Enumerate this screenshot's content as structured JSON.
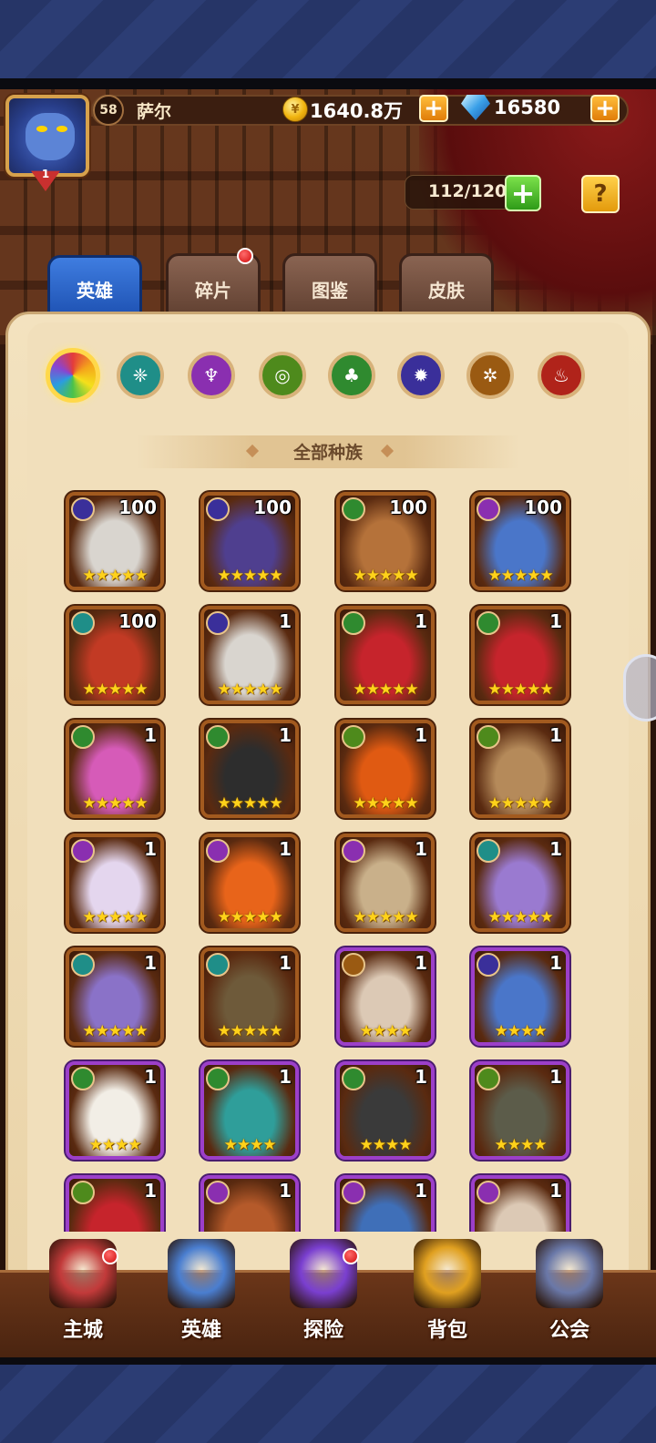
{
  "player": {
    "level": "58",
    "name": "萨尔",
    "vip_level": "1"
  },
  "resources": {
    "gold_icon": "¥",
    "gold": "1640.8万",
    "gems": "16580",
    "stamina": "112/120"
  },
  "buttons": {
    "plus": "+",
    "help": "?"
  },
  "tabs": [
    {
      "label": "英雄",
      "active": true
    },
    {
      "label": "碎片",
      "active": false,
      "notification": true
    },
    {
      "label": "图鉴",
      "active": false
    },
    {
      "label": "皮肤",
      "active": false
    }
  ],
  "race_filters": [
    {
      "name": "all-races",
      "selected": true,
      "color": "rainbow",
      "glyph": ""
    },
    {
      "name": "race-teal",
      "color": "#1f8e88",
      "glyph": "❈"
    },
    {
      "name": "race-purple",
      "color": "#8a2fb0",
      "glyph": "♆"
    },
    {
      "name": "race-green-yellow",
      "color": "#4e8a1c",
      "glyph": "◎"
    },
    {
      "name": "race-forest",
      "color": "#2f8a2f",
      "glyph": "♣"
    },
    {
      "name": "race-indigo",
      "color": "#3a2f9a",
      "glyph": "✹"
    },
    {
      "name": "race-gold",
      "color": "#9a5a12",
      "glyph": "✲"
    },
    {
      "name": "race-red",
      "color": "#b0231a",
      "glyph": "♨"
    }
  ],
  "race_title": "全部种族",
  "heroes": [
    {
      "level": "100",
      "stars": "★★★★★",
      "race_color": "#3a2f9a",
      "frame": "orange",
      "skin": "#d9d5cf"
    },
    {
      "level": "100",
      "stars": "★★★★★",
      "race_color": "#3a2f9a",
      "frame": "orange",
      "skin": "#4f3f8f"
    },
    {
      "level": "100",
      "stars": "★★★★★",
      "race_color": "#2f8a2f",
      "frame": "orange",
      "skin": "#b5723a"
    },
    {
      "level": "100",
      "stars": "★★★★★",
      "race_color": "#8a2fb0",
      "frame": "orange",
      "skin": "#4a76c9"
    },
    {
      "level": "100",
      "stars": "★★★★★",
      "race_color": "#1f8e88",
      "frame": "orange",
      "skin": "#c23a24"
    },
    {
      "level": "1",
      "stars": "★★★★★",
      "race_color": "#3a2f9a",
      "frame": "orange",
      "skin": "#d9d5cf"
    },
    {
      "level": "1",
      "stars": "★★★★★",
      "race_color": "#2f8a2f",
      "frame": "orange",
      "skin": "#c6242c"
    },
    {
      "level": "1",
      "stars": "★★★★★",
      "race_color": "#2f8a2f",
      "frame": "orange",
      "skin": "#c6242c"
    },
    {
      "level": "1",
      "stars": "★★★★★",
      "race_color": "#2f8a2f",
      "frame": "orange",
      "skin": "#d65bb8"
    },
    {
      "level": "1",
      "stars": "★★★★★",
      "race_color": "#2f8a2f",
      "frame": "orange",
      "skin": "#2d2d2d"
    },
    {
      "level": "1",
      "stars": "★★★★★",
      "race_color": "#4e8a1c",
      "frame": "orange",
      "skin": "#e05a12"
    },
    {
      "level": "1",
      "stars": "★★★★★",
      "race_color": "#4e8a1c",
      "frame": "orange",
      "skin": "#b58a5a"
    },
    {
      "level": "1",
      "stars": "★★★★★",
      "race_color": "#8a2fb0",
      "frame": "orange",
      "skin": "#e4d6ee"
    },
    {
      "level": "1",
      "stars": "★★★★★",
      "race_color": "#8a2fb0",
      "frame": "orange",
      "skin": "#e8641a"
    },
    {
      "level": "1",
      "stars": "★★★★★",
      "race_color": "#8a2fb0",
      "frame": "orange",
      "skin": "#c9b08a"
    },
    {
      "level": "1",
      "stars": "★★★★★",
      "race_color": "#1f8e88",
      "frame": "orange",
      "skin": "#9a7ad0"
    },
    {
      "level": "1",
      "stars": "★★★★★",
      "race_color": "#1f8e88",
      "frame": "orange",
      "skin": "#8a72c8"
    },
    {
      "level": "1",
      "stars": "★★★★★",
      "race_color": "#1f8e88",
      "frame": "orange",
      "skin": "#6e5a3a"
    },
    {
      "level": "1",
      "stars": "★★★★",
      "race_color": "#9a5a12",
      "frame": "purple",
      "skin": "#dcc9b5"
    },
    {
      "level": "1",
      "stars": "★★★★",
      "race_color": "#3a2f9a",
      "frame": "purple",
      "skin": "#4a76c9"
    },
    {
      "level": "1",
      "stars": "★★★★",
      "race_color": "#2f8a2f",
      "frame": "purple",
      "skin": "#f2eee6"
    },
    {
      "level": "1",
      "stars": "★★★★",
      "race_color": "#2f8a2f",
      "frame": "purple",
      "skin": "#2f9e9a"
    },
    {
      "level": "1",
      "stars": "★★★★",
      "race_color": "#2f8a2f",
      "frame": "purple",
      "skin": "#3a3a3a"
    },
    {
      "level": "1",
      "stars": "★★★★",
      "race_color": "#4e8a1c",
      "frame": "purple",
      "skin": "#5c5c4a"
    },
    {
      "level": "1",
      "stars": "",
      "race_color": "#4e8a1c",
      "frame": "purple",
      "skin": "#c6242c"
    },
    {
      "level": "1",
      "stars": "",
      "race_color": "#8a2fb0",
      "frame": "purple",
      "skin": "#b55a2a"
    },
    {
      "level": "1",
      "stars": "",
      "race_color": "#8a2fb0",
      "frame": "purple",
      "skin": "#3f6fb8"
    },
    {
      "level": "1",
      "stars": "",
      "race_color": "#8a2fb0",
      "frame": "purple",
      "skin": "#dcc9b5"
    }
  ],
  "nav": [
    {
      "label": "主城",
      "icon": "castle-icon",
      "notification": true,
      "color": "#c23a3a"
    },
    {
      "label": "英雄",
      "icon": "hero-icon",
      "notification": false,
      "color": "#4a7ed0"
    },
    {
      "label": "探险",
      "icon": "portal-icon",
      "notification": true,
      "color": "#7a3fd0"
    },
    {
      "label": "背包",
      "icon": "backpack-icon",
      "notification": false,
      "color": "#e0a020"
    },
    {
      "label": "公会",
      "icon": "guild-icon",
      "notification": false,
      "color": "#6a78a8"
    }
  ]
}
